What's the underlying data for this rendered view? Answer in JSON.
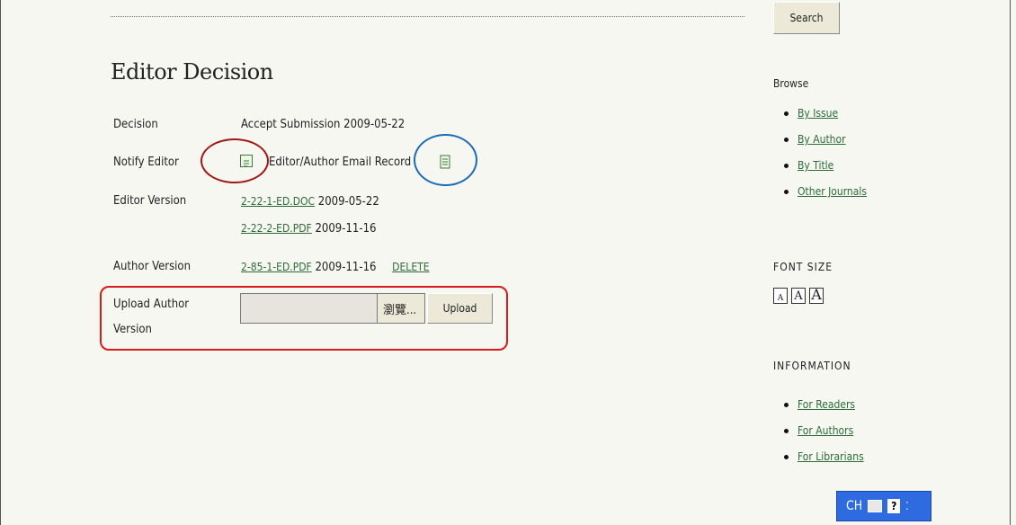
{
  "header": {
    "search_label": "Search"
  },
  "section": {
    "title": "Editor Decision"
  },
  "decision": {
    "label": "Decision",
    "value": "Accept Submission 2009-05-22"
  },
  "notify": {
    "label": "Notify Editor",
    "email_record_label": "Editor/Author Email Record"
  },
  "editor_version": {
    "label": "Editor Version",
    "files": [
      {
        "name": "2-22-1-ED.DOC",
        "date": "2009-05-22"
      },
      {
        "name": "2-22-2-ED.PDF",
        "date": "2009-11-16"
      }
    ]
  },
  "author_version": {
    "label": "Author Version",
    "file": {
      "name": "2-85-1-ED.PDF",
      "date": "2009-11-16"
    },
    "delete_label": "DELETE"
  },
  "upload": {
    "label_line1": "Upload Author",
    "label_line2": "Version",
    "browse_label": "瀏覽...",
    "upload_label": "Upload"
  },
  "sidebar": {
    "browse_title": "Browse",
    "browse_items": [
      {
        "label": "By Issue"
      },
      {
        "label": "By Author"
      },
      {
        "label": "By Title"
      },
      {
        "label": "Other Journals"
      }
    ],
    "font_size_title": "FONT SIZE",
    "font_sizes": [
      "A",
      "A",
      "A"
    ],
    "information_title": "INFORMATION",
    "information_items": [
      {
        "label": "For Readers"
      },
      {
        "label": "For Authors"
      },
      {
        "label": "For Librarians"
      }
    ]
  },
  "language_bar": {
    "label": "CH"
  },
  "colors": {
    "link": "#2c6b3a",
    "annotation_red": "#d81b1b",
    "annotation_blue": "#1a6bb5"
  },
  "icons": [
    "note-icon",
    "document-icon",
    "keyboard-icon",
    "help-icon"
  ]
}
